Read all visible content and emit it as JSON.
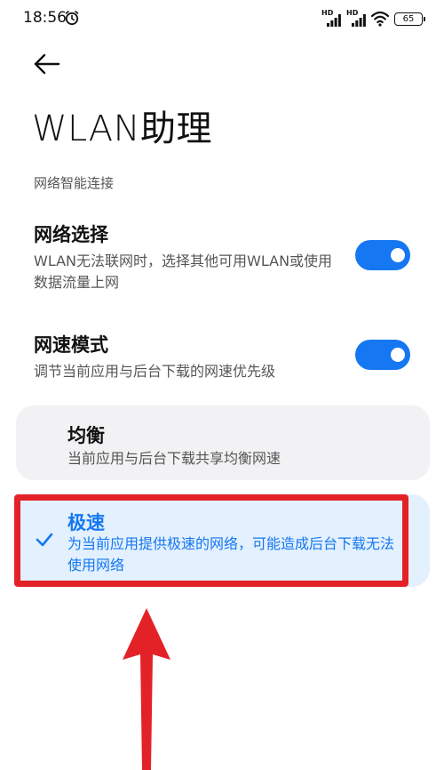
{
  "status_bar": {
    "time": "18:56",
    "hd1": "HD",
    "hd2": "HD",
    "battery": "65",
    "icons": [
      "alarm-icon",
      "signal-icon",
      "wifi-icon",
      "battery-icon"
    ]
  },
  "header": {
    "back_icon": "arrow-left-icon",
    "title": "WLAN助理"
  },
  "section_label": "网络智能连接",
  "settings": [
    {
      "title": "网络选择",
      "desc": "WLAN无法联网时，选择其他可用WLAN或使用数据流量上网",
      "enabled": true
    },
    {
      "title": "网速模式",
      "desc": "调节当前应用与后台下载的网速优先级",
      "enabled": true
    }
  ],
  "speed_options": [
    {
      "title": "均衡",
      "desc": "当前应用与后台下载共享均衡网速",
      "selected": false
    },
    {
      "title": "极速",
      "desc": "为当前应用提供极速的网络，可能造成后台下载无法使用网络",
      "selected": true
    }
  ],
  "colors": {
    "accent": "#1577f2",
    "selected_card_bg": "#e3f0fd",
    "card_bg": "#f2f2f4",
    "annotation_red": "#e32227"
  }
}
